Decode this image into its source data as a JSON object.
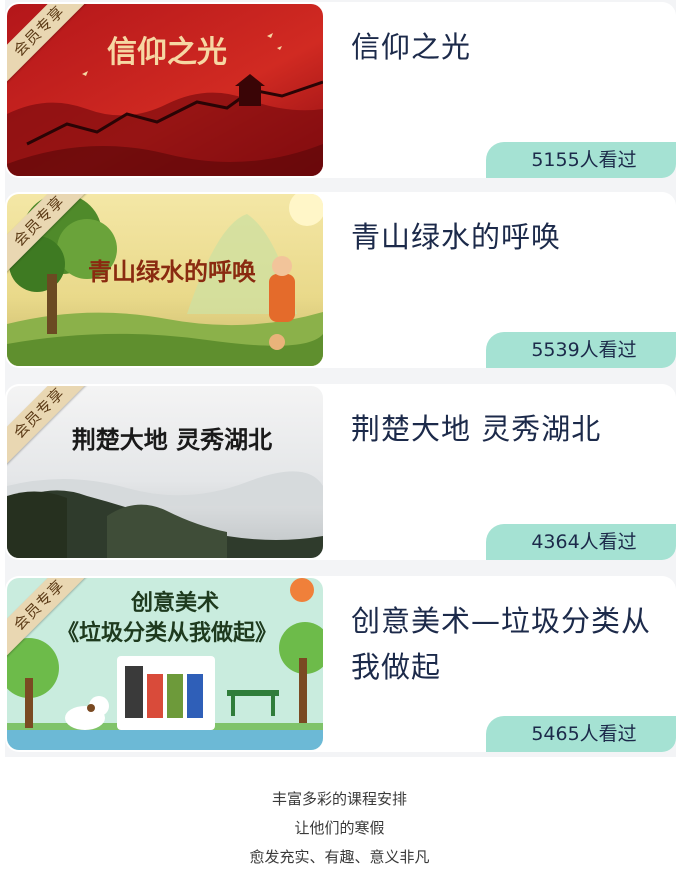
{
  "member_badge": "会员专享",
  "courses": [
    {
      "title": "信仰之光",
      "thumb_text": "信仰之光",
      "views": "5155人看过"
    },
    {
      "title": "青山绿水的呼唤",
      "thumb_text": "青山绿水的呼唤",
      "views": "5539人看过"
    },
    {
      "title": "荆楚大地 灵秀湖北",
      "thumb_text": "荆楚大地  灵秀湖北",
      "views": "4364人看过"
    },
    {
      "title": "创意美术—垃圾分类从我做起",
      "thumb_text_line1": "创意美术",
      "thumb_text_line2": "《垃圾分类从我做起》",
      "views": "5465人看过"
    }
  ],
  "footer": {
    "line1": "丰富多彩的课程安排",
    "line2": "让他们的寒假",
    "line3": "愈发充实、有趣、意义非凡"
  },
  "colors": {
    "list_background": "#f3f4f6",
    "views_badge": "#a5e2d3",
    "title_text": "#1c2a4a",
    "member_ribbon": "#e9d7b2"
  }
}
